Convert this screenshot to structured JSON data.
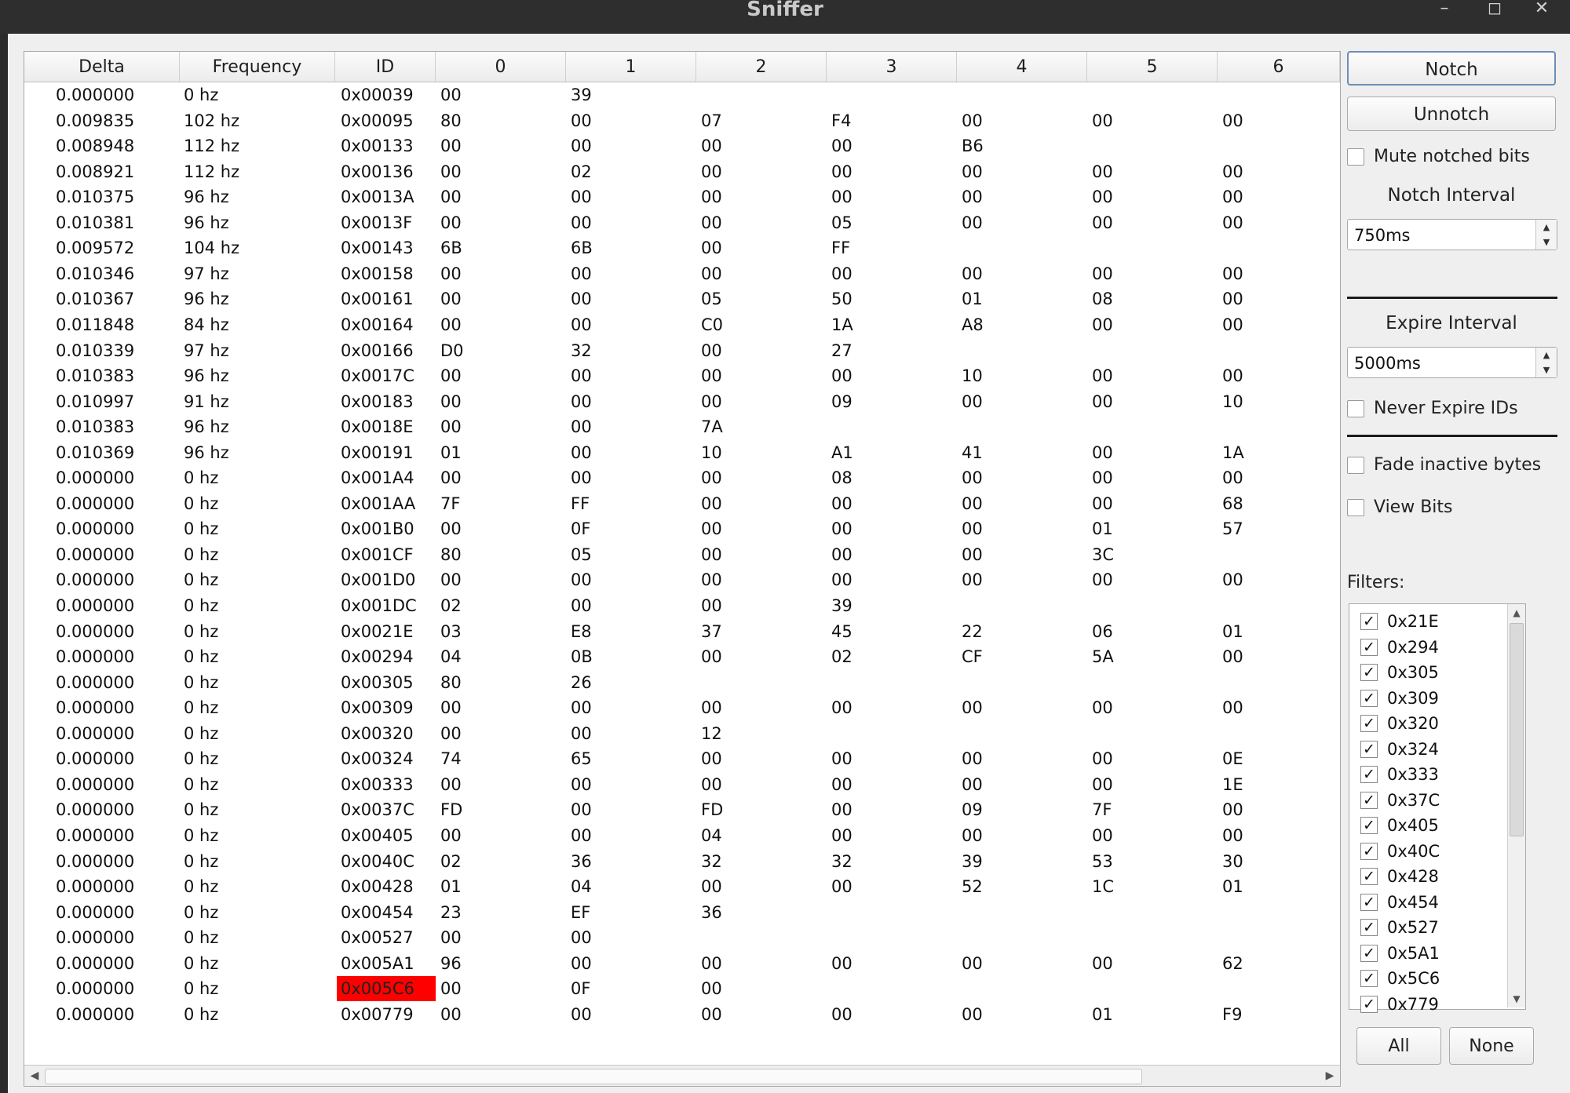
{
  "window": {
    "title": "Sniffer",
    "controls": [
      "minimize-icon",
      "maximize-icon",
      "close-icon"
    ]
  },
  "table": {
    "columns": [
      "Delta",
      "Frequency",
      "ID",
      "0",
      "1",
      "2",
      "3",
      "4",
      "5",
      "6"
    ],
    "highlight_color": "#ff0000",
    "rows": [
      {
        "delta": "0.000000",
        "freq": "0 hz",
        "id": "0x00039",
        "bytes": [
          "00",
          "39",
          "",
          "",
          "",
          "",
          ""
        ]
      },
      {
        "delta": "0.009835",
        "freq": "102 hz",
        "id": "0x00095",
        "bytes": [
          "80",
          "00",
          "07",
          "F4",
          "00",
          "00",
          "00"
        ]
      },
      {
        "delta": "0.008948",
        "freq": "112 hz",
        "id": "0x00133",
        "bytes": [
          "00",
          "00",
          "00",
          "00",
          "B6",
          "",
          ""
        ]
      },
      {
        "delta": "0.008921",
        "freq": "112 hz",
        "id": "0x00136",
        "bytes": [
          "00",
          "02",
          "00",
          "00",
          "00",
          "00",
          "00"
        ]
      },
      {
        "delta": "0.010375",
        "freq": "96 hz",
        "id": "0x0013A",
        "bytes": [
          "00",
          "00",
          "00",
          "00",
          "00",
          "00",
          "00"
        ]
      },
      {
        "delta": "0.010381",
        "freq": "96 hz",
        "id": "0x0013F",
        "bytes": [
          "00",
          "00",
          "00",
          "05",
          "00",
          "00",
          "00"
        ]
      },
      {
        "delta": "0.009572",
        "freq": "104 hz",
        "id": "0x00143",
        "bytes": [
          "6B",
          "6B",
          "00",
          "FF",
          "",
          "",
          ""
        ]
      },
      {
        "delta": "0.010346",
        "freq": "97 hz",
        "id": "0x00158",
        "bytes": [
          "00",
          "00",
          "00",
          "00",
          "00",
          "00",
          "00"
        ]
      },
      {
        "delta": "0.010367",
        "freq": "96 hz",
        "id": "0x00161",
        "bytes": [
          "00",
          "00",
          "05",
          "50",
          "01",
          "08",
          "00"
        ]
      },
      {
        "delta": "0.011848",
        "freq": "84 hz",
        "id": "0x00164",
        "bytes": [
          "00",
          "00",
          "C0",
          "1A",
          "A8",
          "00",
          "00"
        ]
      },
      {
        "delta": "0.010339",
        "freq": "97 hz",
        "id": "0x00166",
        "bytes": [
          "D0",
          "32",
          "00",
          "27",
          "",
          "",
          ""
        ]
      },
      {
        "delta": "0.010383",
        "freq": "96 hz",
        "id": "0x0017C",
        "bytes": [
          "00",
          "00",
          "00",
          "00",
          "10",
          "00",
          "00"
        ]
      },
      {
        "delta": "0.010997",
        "freq": "91 hz",
        "id": "0x00183",
        "bytes": [
          "00",
          "00",
          "00",
          "09",
          "00",
          "00",
          "10"
        ]
      },
      {
        "delta": "0.010383",
        "freq": "96 hz",
        "id": "0x0018E",
        "bytes": [
          "00",
          "00",
          "7A",
          "",
          "",
          "",
          ""
        ]
      },
      {
        "delta": "0.010369",
        "freq": "96 hz",
        "id": "0x00191",
        "bytes": [
          "01",
          "00",
          "10",
          "A1",
          "41",
          "00",
          "1A"
        ]
      },
      {
        "delta": "0.000000",
        "freq": "0 hz",
        "id": "0x001A4",
        "bytes": [
          "00",
          "00",
          "00",
          "08",
          "00",
          "00",
          "00"
        ]
      },
      {
        "delta": "0.000000",
        "freq": "0 hz",
        "id": "0x001AA",
        "bytes": [
          "7F",
          "FF",
          "00",
          "00",
          "00",
          "00",
          "68"
        ]
      },
      {
        "delta": "0.000000",
        "freq": "0 hz",
        "id": "0x001B0",
        "bytes": [
          "00",
          "0F",
          "00",
          "00",
          "00",
          "01",
          "57"
        ]
      },
      {
        "delta": "0.000000",
        "freq": "0 hz",
        "id": "0x001CF",
        "bytes": [
          "80",
          "05",
          "00",
          "00",
          "00",
          "3C",
          ""
        ]
      },
      {
        "delta": "0.000000",
        "freq": "0 hz",
        "id": "0x001D0",
        "bytes": [
          "00",
          "00",
          "00",
          "00",
          "00",
          "00",
          "00"
        ]
      },
      {
        "delta": "0.000000",
        "freq": "0 hz",
        "id": "0x001DC",
        "bytes": [
          "02",
          "00",
          "00",
          "39",
          "",
          "",
          ""
        ]
      },
      {
        "delta": "0.000000",
        "freq": "0 hz",
        "id": "0x0021E",
        "bytes": [
          "03",
          "E8",
          "37",
          "45",
          "22",
          "06",
          "01"
        ]
      },
      {
        "delta": "0.000000",
        "freq": "0 hz",
        "id": "0x00294",
        "bytes": [
          "04",
          "0B",
          "00",
          "02",
          "CF",
          "5A",
          "00"
        ]
      },
      {
        "delta": "0.000000",
        "freq": "0 hz",
        "id": "0x00305",
        "bytes": [
          "80",
          "26",
          "",
          "",
          "",
          "",
          ""
        ]
      },
      {
        "delta": "0.000000",
        "freq": "0 hz",
        "id": "0x00309",
        "bytes": [
          "00",
          "00",
          "00",
          "00",
          "00",
          "00",
          "00"
        ]
      },
      {
        "delta": "0.000000",
        "freq": "0 hz",
        "id": "0x00320",
        "bytes": [
          "00",
          "00",
          "12",
          "",
          "",
          "",
          ""
        ]
      },
      {
        "delta": "0.000000",
        "freq": "0 hz",
        "id": "0x00324",
        "bytes": [
          "74",
          "65",
          "00",
          "00",
          "00",
          "00",
          "0E"
        ]
      },
      {
        "delta": "0.000000",
        "freq": "0 hz",
        "id": "0x00333",
        "bytes": [
          "00",
          "00",
          "00",
          "00",
          "00",
          "00",
          "1E"
        ]
      },
      {
        "delta": "0.000000",
        "freq": "0 hz",
        "id": "0x0037C",
        "bytes": [
          "FD",
          "00",
          "FD",
          "00",
          "09",
          "7F",
          "00"
        ]
      },
      {
        "delta": "0.000000",
        "freq": "0 hz",
        "id": "0x00405",
        "bytes": [
          "00",
          "00",
          "04",
          "00",
          "00",
          "00",
          "00"
        ]
      },
      {
        "delta": "0.000000",
        "freq": "0 hz",
        "id": "0x0040C",
        "bytes": [
          "02",
          "36",
          "32",
          "32",
          "39",
          "53",
          "30"
        ]
      },
      {
        "delta": "0.000000",
        "freq": "0 hz",
        "id": "0x00428",
        "bytes": [
          "01",
          "04",
          "00",
          "00",
          "52",
          "1C",
          "01"
        ]
      },
      {
        "delta": "0.000000",
        "freq": "0 hz",
        "id": "0x00454",
        "bytes": [
          "23",
          "EF",
          "36",
          "",
          "",
          "",
          ""
        ]
      },
      {
        "delta": "0.000000",
        "freq": "0 hz",
        "id": "0x00527",
        "bytes": [
          "00",
          "00",
          "",
          "",
          "",
          "",
          ""
        ]
      },
      {
        "delta": "0.000000",
        "freq": "0 hz",
        "id": "0x005A1",
        "bytes": [
          "96",
          "00",
          "00",
          "00",
          "00",
          "00",
          "62"
        ]
      },
      {
        "delta": "0.000000",
        "freq": "0 hz",
        "id": "0x005C6",
        "bytes": [
          "00",
          "0F",
          "00",
          "",
          "",
          "",
          ""
        ],
        "highlight": true
      },
      {
        "delta": "0.000000",
        "freq": "0 hz",
        "id": "0x00779",
        "bytes": [
          "00",
          "00",
          "00",
          "00",
          "00",
          "01",
          "F9"
        ]
      }
    ]
  },
  "sidebar": {
    "notch_label": "Notch",
    "unnotch_label": "Unnotch",
    "mute_notched_label": "Mute notched bits",
    "notch_interval_label": "Notch Interval",
    "notch_interval_value": "750ms",
    "expire_interval_label": "Expire Interval",
    "expire_interval_value": "5000ms",
    "never_expire_label": "Never Expire IDs",
    "fade_inactive_label": "Fade inactive bytes",
    "view_bits_label": "View Bits",
    "filters_label": "Filters:",
    "filters": [
      "0x21E",
      "0x294",
      "0x305",
      "0x309",
      "0x320",
      "0x324",
      "0x333",
      "0x37C",
      "0x405",
      "0x40C",
      "0x428",
      "0x454",
      "0x527",
      "0x5A1",
      "0x5C6",
      "0x779"
    ],
    "all_label": "All",
    "none_label": "None"
  }
}
